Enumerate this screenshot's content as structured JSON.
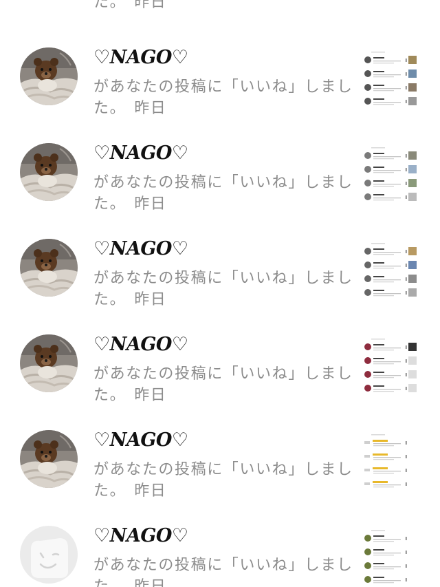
{
  "partial_top": {
    "message_tail": "た。",
    "time": "昨日"
  },
  "notifications": [
    {
      "username": "♡NAGO♡",
      "message": "があなたの投稿に「いいね」しまし",
      "message_tail": "た。",
      "time": "昨日",
      "avatar": "teddy-bear-photo",
      "thumb_style": "mixed"
    },
    {
      "username": "♡NAGO♡",
      "message": "があなたの投稿に「いいね」しまし",
      "message_tail": "た。",
      "time": "昨日",
      "avatar": "teddy-bear-photo",
      "thumb_style": "grey"
    },
    {
      "username": "♡NAGO♡",
      "message": "があなたの投稿に「いいね」しまし",
      "message_tail": "た。",
      "time": "昨日",
      "avatar": "teddy-bear-photo",
      "thumb_style": "grey-images"
    },
    {
      "username": "♡NAGO♡",
      "message": "があなたの投稿に「いいね」しまし",
      "message_tail": "た。",
      "time": "昨日",
      "avatar": "teddy-bear-photo",
      "thumb_style": "red"
    },
    {
      "username": "♡NAGO♡",
      "message": "があなたの投稿に「いいね」しまし",
      "message_tail": "た。",
      "time": "昨日",
      "avatar": "teddy-bear-photo",
      "thumb_style": "yellow"
    },
    {
      "username": "♡NAGO♡",
      "message": "があなたの投稿に「いいね」しまし",
      "message_tail": "た。",
      "time": "昨日",
      "avatar": "default-wink-face",
      "thumb_style": "green"
    }
  ],
  "colors": {
    "username": "#111111",
    "message": "#8c8c8c",
    "background": "#ffffff"
  }
}
